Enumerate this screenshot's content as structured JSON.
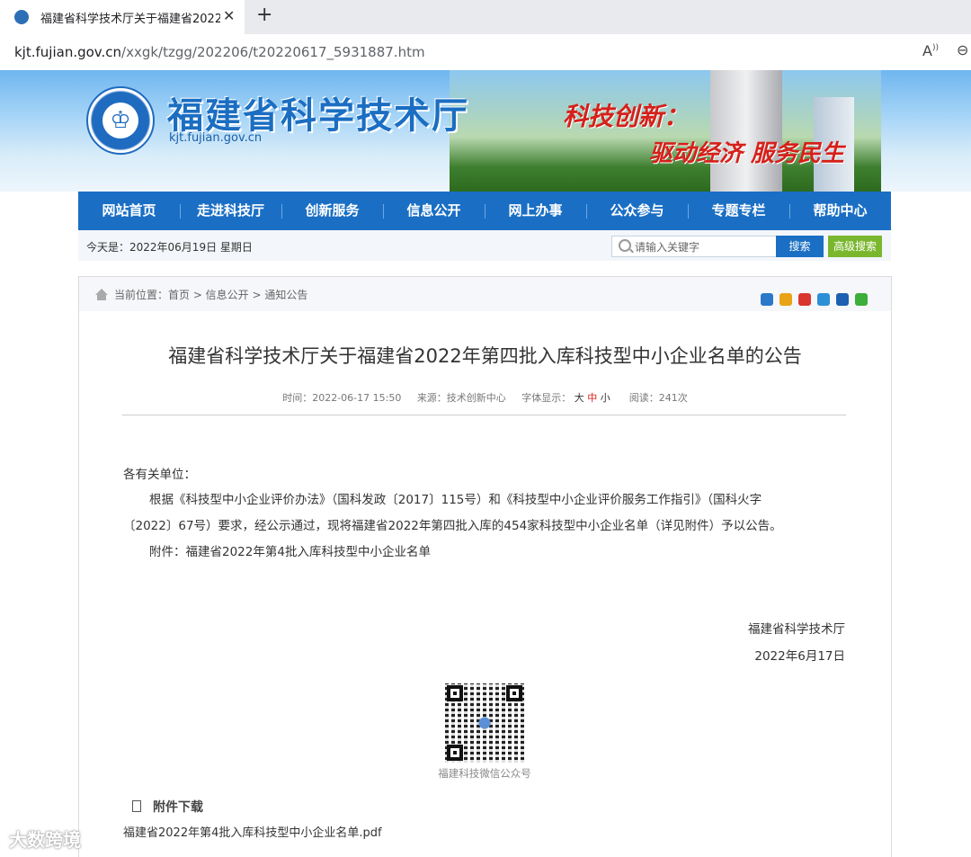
{
  "browser": {
    "tab_title": "福建省科学技术厅关于福建省2022",
    "url_host": "kjt.fujian.gov.cn",
    "url_path": "/xxgk/tzgg/202206/t20220617_5931887.htm"
  },
  "header": {
    "site_name": "福建省科学技术厅",
    "domain": "kjt.fujian.gov.cn",
    "slogan_line1": "科技创新：",
    "slogan_line2": "驱动经济 服务民生"
  },
  "nav": {
    "items": [
      "网站首页",
      "走进科技厅",
      "创新服务",
      "信息公开",
      "网上办事",
      "公众参与",
      "专题专栏",
      "帮助中心"
    ]
  },
  "toolbar": {
    "today": "今天是：2022年06月19日  星期日",
    "search_placeholder": "请输入关键字",
    "search_label": "搜索",
    "advanced_search_label": "高级搜索"
  },
  "breadcrumb": {
    "text": "当前位置：首页 > 信息公开 > 通知公告"
  },
  "share_icons": [
    {
      "name": "plus-share-icon",
      "color": "#2c78c8"
    },
    {
      "name": "qzone-share-icon",
      "color": "#e8a317"
    },
    {
      "name": "weibo-share-icon",
      "color": "#d9372d"
    },
    {
      "name": "tencent-share-icon",
      "color": "#2d8fd6"
    },
    {
      "name": "renren-share-icon",
      "color": "#1d5fb0"
    },
    {
      "name": "wechat-share-icon",
      "color": "#3cae3a"
    }
  ],
  "article": {
    "title": "福建省科学技术厅关于福建省2022年第四批入库科技型中小企业名单的公告",
    "meta_time": "时间：2022-06-17 15:50",
    "meta_source": "来源：技术创新中心",
    "meta_font_label": "字体显示：",
    "font_large": "大",
    "font_medium": "中",
    "font_small": "小",
    "meta_reads": "阅读：241次",
    "salutation": "各有关单位：",
    "body_line1": "根据《科技型中小企业评价办法》（国科发政〔2017〕115号）和《科技型中小企业评价服务工作指引》（国科火字",
    "body_line2": "〔2022〕67号）要求，经公示通过，现将福建省2022年第四批入库的454家科技型中小企业名单（详见附件）予以公告。",
    "attachment_note": "附件：福建省2022年第4批入库科技型中小企业名单",
    "signature": "福建省科学技术厅",
    "date": "2022年6月17日",
    "qr_caption": "福建科技微信公众号",
    "download_title": "附件下载",
    "download_file": "福建省2022年第4批入库科技型中小企业名单.pdf"
  },
  "watermark": "大数跨境"
}
